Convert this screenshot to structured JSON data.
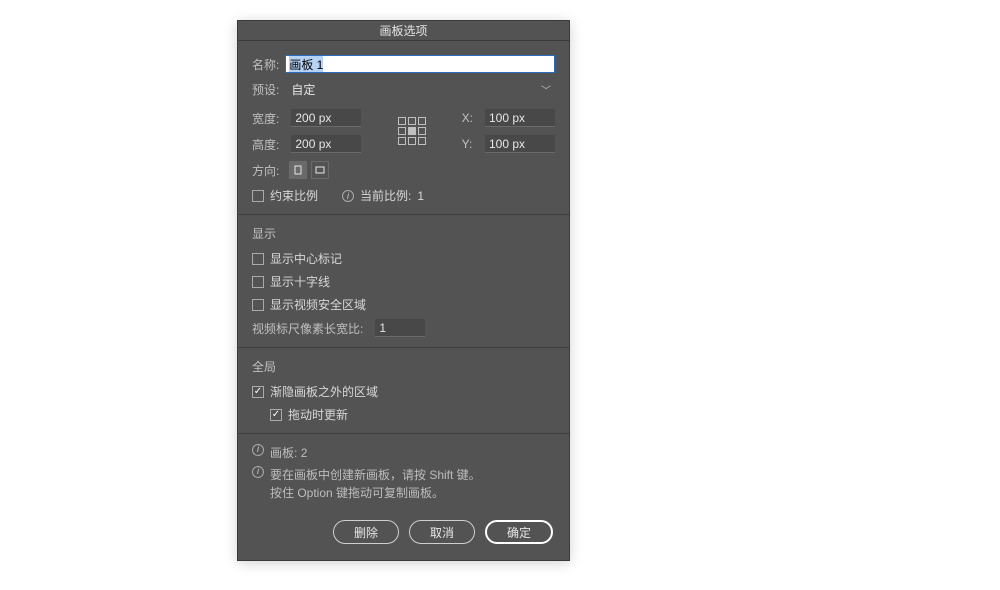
{
  "dialog": {
    "title": "画板选项",
    "name_label": "名称:",
    "name_value": "画板 1",
    "preset_label": "预设:",
    "preset_value": "自定",
    "width_label": "宽度:",
    "width_value": "200 px",
    "height_label": "高度:",
    "height_value": "200 px",
    "x_label": "X:",
    "x_value": "100 px",
    "y_label": "Y:",
    "y_value": "100 px",
    "orientation_label": "方向:",
    "constrain_label": "约束比例",
    "current_ratio_label": "当前比例:",
    "current_ratio_value": "1"
  },
  "display": {
    "section": "显示",
    "show_center": "显示中心标记",
    "show_cross": "显示十字线",
    "show_safe": "显示视频安全区域",
    "pixel_aspect_label": "视频标尺像素长宽比:",
    "pixel_aspect_value": "1"
  },
  "global": {
    "section": "全局",
    "fade_outside": "渐隐画板之外的区域",
    "update_drag": "拖动时更新"
  },
  "info": {
    "artboard_count_label": "画板:",
    "artboard_count_value": "2",
    "hint1": "要在画板中创建新画板，请按 Shift 键。",
    "hint2": "按住 Option 键拖动可复制画板。"
  },
  "buttons": {
    "delete": "删除",
    "cancel": "取消",
    "ok": "确定"
  }
}
